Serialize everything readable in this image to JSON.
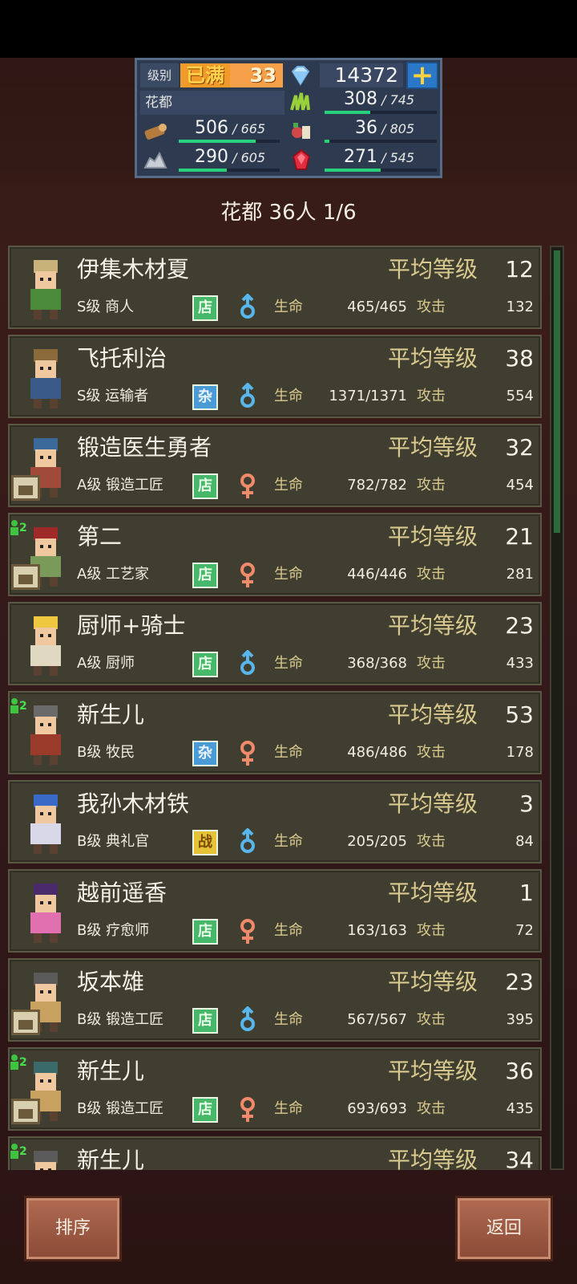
{
  "resources": {
    "level_label": "级别",
    "level_status": "已满",
    "level": "33",
    "gems": "14372",
    "plus": "+",
    "town": "花都",
    "items": [
      {
        "icon": "grass-icon",
        "value": "308",
        "max": "/ 745",
        "fill": 0.41
      },
      {
        "icon": "wood-icon",
        "value": "506",
        "max": "/ 665",
        "fill": 0.76
      },
      {
        "icon": "food-icon",
        "value": "36",
        "max": "/ 805",
        "fill": 0.04
      },
      {
        "icon": "ore-icon",
        "value": "290",
        "max": "/ 605",
        "fill": 0.48
      },
      {
        "icon": "ruby-icon",
        "value": "271",
        "max": "/ 545",
        "fill": 0.5
      }
    ]
  },
  "header": "花都  36人 1/6",
  "residents": [
    {
      "name": "伊集木材夏",
      "avg_label": "平均等级",
      "avg": "12",
      "rank_job": "S级 商人",
      "badge": "店",
      "badge_type": "dian",
      "gender": "male",
      "hp_label": "生命",
      "hp": "465/465",
      "atk_label": "攻击",
      "atk": "132",
      "shop": false,
      "promo": ""
    },
    {
      "name": "飞托利治",
      "avg_label": "平均等级",
      "avg": "38",
      "rank_job": "S级 运输者",
      "badge": "杂",
      "badge_type": "za",
      "gender": "male",
      "hp_label": "生命",
      "hp": "1371/1371",
      "atk_label": "攻击",
      "atk": "554",
      "shop": false,
      "promo": ""
    },
    {
      "name": "锻造医生勇者",
      "avg_label": "平均等级",
      "avg": "32",
      "rank_job": "A级 锻造工匠",
      "badge": "店",
      "badge_type": "dian",
      "gender": "female",
      "hp_label": "生命",
      "hp": "782/782",
      "atk_label": "攻击",
      "atk": "454",
      "shop": true,
      "promo": ""
    },
    {
      "name": "第二",
      "avg_label": "平均等级",
      "avg": "21",
      "rank_job": "A级 工艺家",
      "badge": "店",
      "badge_type": "dian",
      "gender": "female",
      "hp_label": "生命",
      "hp": "446/446",
      "atk_label": "攻击",
      "atk": "281",
      "shop": true,
      "promo": "2"
    },
    {
      "name": "厨师+骑士",
      "avg_label": "平均等级",
      "avg": "23",
      "rank_job": "A级 厨师",
      "badge": "店",
      "badge_type": "dian",
      "gender": "male",
      "hp_label": "生命",
      "hp": "368/368",
      "atk_label": "攻击",
      "atk": "433",
      "shop": false,
      "promo": ""
    },
    {
      "name": "新生儿",
      "avg_label": "平均等级",
      "avg": "53",
      "rank_job": "B级 牧民",
      "badge": "杂",
      "badge_type": "za",
      "gender": "female",
      "hp_label": "生命",
      "hp": "486/486",
      "atk_label": "攻击",
      "atk": "178",
      "shop": false,
      "promo": "2"
    },
    {
      "name": "我孙木材铁",
      "avg_label": "平均等级",
      "avg": "3",
      "rank_job": "B级 典礼官",
      "badge": "战",
      "badge_type": "zhan",
      "gender": "male",
      "hp_label": "生命",
      "hp": "205/205",
      "atk_label": "攻击",
      "atk": "84",
      "shop": false,
      "promo": ""
    },
    {
      "name": "越前遥香",
      "avg_label": "平均等级",
      "avg": "1",
      "rank_job": "B级 疗愈师",
      "badge": "店",
      "badge_type": "dian",
      "gender": "female",
      "hp_label": "生命",
      "hp": "163/163",
      "atk_label": "攻击",
      "atk": "72",
      "shop": false,
      "promo": ""
    },
    {
      "name": "坂本雄",
      "avg_label": "平均等级",
      "avg": "23",
      "rank_job": "B级 锻造工匠",
      "badge": "店",
      "badge_type": "dian",
      "gender": "male",
      "hp_label": "生命",
      "hp": "567/567",
      "atk_label": "攻击",
      "atk": "395",
      "shop": true,
      "promo": ""
    },
    {
      "name": "新生儿",
      "avg_label": "平均等级",
      "avg": "36",
      "rank_job": "B级 锻造工匠",
      "badge": "店",
      "badge_type": "dian",
      "gender": "female",
      "hp_label": "生命",
      "hp": "693/693",
      "atk_label": "攻击",
      "atk": "435",
      "shop": true,
      "promo": "2"
    },
    {
      "name": "新生儿",
      "avg_label": "平均等级",
      "avg": "34",
      "rank_job": "",
      "badge": "",
      "badge_type": "",
      "gender": "",
      "hp_label": "",
      "hp": "",
      "atk_label": "",
      "atk": "",
      "shop": false,
      "promo": "2"
    }
  ],
  "buttons": {
    "sort": "排序",
    "back": "返回"
  },
  "colors": {
    "accent": "#27d07a",
    "panel": "#2d3a50",
    "row": "#3f3e30",
    "button": "#a0604a"
  },
  "scroll": {
    "position": 0.0,
    "visible_fraction": 0.31
  }
}
